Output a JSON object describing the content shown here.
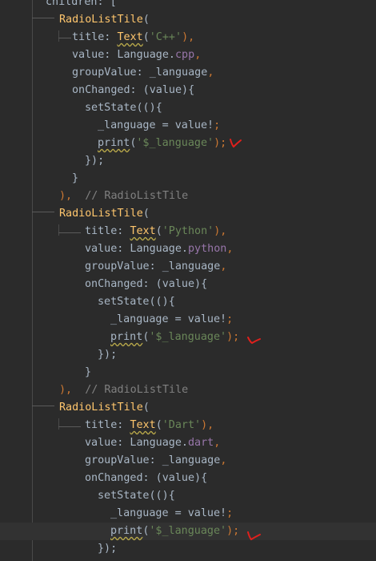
{
  "editor": {
    "lines": [
      {
        "tokens": [
          {
            "t": "children: [",
            "c": "p"
          }
        ]
      },
      {
        "tokens": [
          {
            "t": "RadioListTile",
            "c": "c"
          },
          {
            "t": "(",
            "c": "p"
          }
        ]
      },
      {
        "tokens": [
          {
            "t": "title: ",
            "c": "p"
          },
          {
            "t": "Text",
            "c": "c",
            "u": true
          },
          {
            "t": "(",
            "c": "p"
          },
          {
            "t": "'C++'",
            "c": "s"
          },
          {
            "t": "),",
            "c": "k"
          }
        ]
      },
      {
        "tokens": [
          {
            "t": "value: Language.",
            "c": "p"
          },
          {
            "t": "cpp",
            "c": "f"
          },
          {
            "t": ",",
            "c": "k"
          }
        ]
      },
      {
        "tokens": [
          {
            "t": "groupValue: _language",
            "c": "p"
          },
          {
            "t": ",",
            "c": "k"
          }
        ]
      },
      {
        "tokens": [
          {
            "t": "onChanged: (value){",
            "c": "p"
          }
        ]
      },
      {
        "tokens": [
          {
            "t": "setState(()",
            "c": "p"
          },
          {
            "t": "{",
            "c": "p"
          }
        ]
      },
      {
        "tokens": [
          {
            "t": "_language = value!",
            "c": "p"
          },
          {
            "t": ";",
            "c": "k"
          }
        ]
      },
      {
        "tokens": [
          {
            "t": "print",
            "c": "p",
            "u": true
          },
          {
            "t": "(",
            "c": "p"
          },
          {
            "t": "'$_language'",
            "c": "s"
          },
          {
            "t": ");",
            "c": "k"
          }
        ]
      },
      {
        "tokens": [
          {
            "t": "});",
            "c": "p"
          }
        ]
      },
      {
        "tokens": [
          {
            "t": "}",
            "c": "p"
          }
        ]
      },
      {
        "tokens": [
          {
            "t": "),",
            "c": "k"
          },
          {
            "t": "  // RadioListTile",
            "c": "d"
          }
        ]
      },
      {
        "tokens": [
          {
            "t": "RadioListTile",
            "c": "c"
          },
          {
            "t": "(",
            "c": "p"
          }
        ]
      },
      {
        "tokens": [
          {
            "t": "title: ",
            "c": "p"
          },
          {
            "t": "Text",
            "c": "c",
            "u": true
          },
          {
            "t": "(",
            "c": "p"
          },
          {
            "t": "'Python'",
            "c": "s"
          },
          {
            "t": "),",
            "c": "k"
          }
        ]
      },
      {
        "tokens": [
          {
            "t": "value: Language.",
            "c": "p"
          },
          {
            "t": "python",
            "c": "f"
          },
          {
            "t": ",",
            "c": "k"
          }
        ]
      },
      {
        "tokens": [
          {
            "t": "groupValue: _language",
            "c": "p"
          },
          {
            "t": ",",
            "c": "k"
          }
        ]
      },
      {
        "tokens": [
          {
            "t": "onChanged: (value){",
            "c": "p"
          }
        ]
      },
      {
        "tokens": [
          {
            "t": "setState(()",
            "c": "p"
          },
          {
            "t": "{",
            "c": "p"
          }
        ]
      },
      {
        "tokens": [
          {
            "t": "_language = value!",
            "c": "p"
          },
          {
            "t": ";",
            "c": "k"
          }
        ]
      },
      {
        "tokens": [
          {
            "t": "print",
            "c": "p",
            "u": true
          },
          {
            "t": "(",
            "c": "p"
          },
          {
            "t": "'$_language'",
            "c": "s"
          },
          {
            "t": ");",
            "c": "k"
          }
        ]
      },
      {
        "tokens": [
          {
            "t": "});",
            "c": "p"
          }
        ]
      },
      {
        "tokens": [
          {
            "t": "}",
            "c": "p"
          }
        ]
      },
      {
        "tokens": [
          {
            "t": "),",
            "c": "k"
          },
          {
            "t": "  // RadioListTile",
            "c": "d"
          }
        ]
      },
      {
        "tokens": [
          {
            "t": "RadioListTile",
            "c": "c"
          },
          {
            "t": "(",
            "c": "p"
          }
        ]
      },
      {
        "tokens": [
          {
            "t": "title: ",
            "c": "p"
          },
          {
            "t": "Text",
            "c": "c",
            "u": true
          },
          {
            "t": "(",
            "c": "p"
          },
          {
            "t": "'Dart'",
            "c": "s"
          },
          {
            "t": "),",
            "c": "k"
          }
        ]
      },
      {
        "tokens": [
          {
            "t": "value: Language.",
            "c": "p"
          },
          {
            "t": "dart",
            "c": "f"
          },
          {
            "t": ",",
            "c": "k"
          }
        ]
      },
      {
        "tokens": [
          {
            "t": "groupValue: _language",
            "c": "p"
          },
          {
            "t": ",",
            "c": "k"
          }
        ]
      },
      {
        "tokens": [
          {
            "t": "onChanged: (value){",
            "c": "p"
          }
        ]
      },
      {
        "tokens": [
          {
            "t": "setState(()",
            "c": "p"
          },
          {
            "t": "{",
            "c": "p"
          }
        ]
      },
      {
        "tokens": [
          {
            "t": "_language = value!",
            "c": "p"
          },
          {
            "t": ";",
            "c": "k"
          }
        ]
      },
      {
        "tokens": [
          {
            "t": "print",
            "c": "p",
            "u": true
          },
          {
            "t": "(",
            "c": "p"
          },
          {
            "t": "'$_language'",
            "c": "s"
          },
          {
            "t": ");",
            "c": "k"
          }
        ]
      },
      {
        "tokens": [
          {
            "t": "});",
            "c": "p"
          }
        ]
      }
    ]
  },
  "colors": {
    "background": "#2b2b2b",
    "current_line": "#323232",
    "keyword_punctuation": "#cc7832",
    "class_name": "#ffc66d",
    "string": "#6a8759",
    "field": "#9876aa",
    "plain": "#a9b7c6",
    "comment": "#808080",
    "annotation_mark": "#e0201c"
  },
  "annotations": {
    "icon": "red-check-mark-icon",
    "count": 3
  }
}
